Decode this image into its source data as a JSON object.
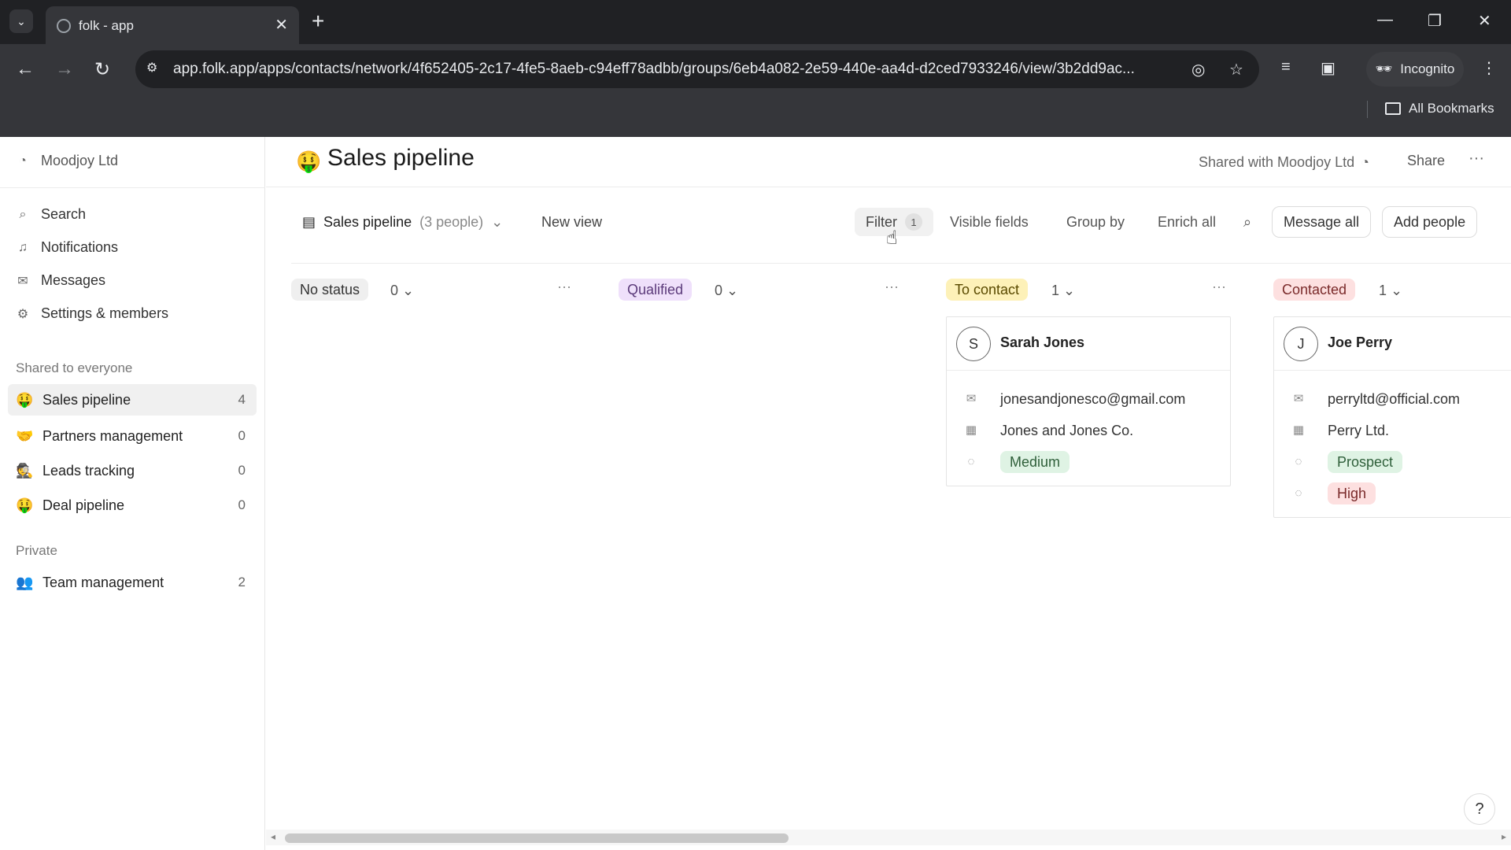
{
  "browser": {
    "tab_title": "folk - app",
    "url": "app.folk.app/apps/contacts/network/4f652405-2c17-4fe5-8aeb-c94eff78adbb/groups/6eb4a082-2e59-440e-aa4d-d2ced7933246/view/3b2dd9ac...",
    "incognito_label": "Incognito",
    "bookmarks_label": "All Bookmarks"
  },
  "sidebar": {
    "workspace": "Moodjoy Ltd",
    "nav": [
      {
        "label": "Search",
        "icon": "search-icon"
      },
      {
        "label": "Notifications",
        "icon": "bell-icon"
      },
      {
        "label": "Messages",
        "icon": "mail-icon"
      },
      {
        "label": "Settings & members",
        "icon": "gear-icon"
      }
    ],
    "shared_label": "Shared to everyone",
    "shared_groups": [
      {
        "emoji": "🤑",
        "label": "Sales pipeline",
        "count": "4"
      },
      {
        "emoji": "🤝",
        "label": "Partners management",
        "count": "0"
      },
      {
        "emoji": "🕵",
        "label": "Leads tracking",
        "count": "0"
      },
      {
        "emoji": "🤑",
        "label": "Deal pipeline",
        "count": "0"
      }
    ],
    "private_label": "Private",
    "private_groups": [
      {
        "emoji": "👥",
        "label": "Team management",
        "count": "2"
      }
    ]
  },
  "header": {
    "emoji": "🤑",
    "title": "Sales pipeline",
    "shared_with": "Shared with Moodjoy Ltd",
    "share": "Share"
  },
  "viewbar": {
    "view_name": "Sales pipeline",
    "view_count": "(3 people)",
    "new_view": "New view",
    "filter": "Filter",
    "filter_count": "1",
    "visible_fields": "Visible fields",
    "group_by": "Group by",
    "enrich_all": "Enrich all",
    "message_all": "Message all",
    "add_people": "Add people"
  },
  "columns": [
    {
      "status": "No status",
      "count": "0",
      "pill_bg": "#efefef",
      "pill_fg": "#333333",
      "cards": []
    },
    {
      "status": "Qualified",
      "count": "0",
      "pill_bg": "#efe0fb",
      "pill_fg": "#5b3a7a",
      "cards": []
    },
    {
      "status": "To contact",
      "count": "1",
      "pill_bg": "#fdf1b8",
      "pill_fg": "#5a4a00",
      "cards": [
        {
          "initial": "S",
          "name": "Sarah Jones",
          "email": "jonesandjonesco@gmail.com",
          "company": "Jones and Jones Co.",
          "tags": [
            {
              "label": "Medium",
              "bg": "#dff3e4",
              "fg": "#2f5f3a"
            }
          ]
        }
      ]
    },
    {
      "status": "Contacted",
      "count": "1",
      "pill_bg": "#fde0e0",
      "pill_fg": "#7a2a2a",
      "cards": [
        {
          "initial": "J",
          "name": "Joe Perry",
          "email": "perryltd@official.com",
          "company": "Perry Ltd.",
          "tags": [
            {
              "label": "Prospect",
              "bg": "#dff3e4",
              "fg": "#2f5f3a"
            },
            {
              "label": "High",
              "bg": "#fde0e0",
              "fg": "#7a2a2a"
            }
          ]
        }
      ]
    }
  ],
  "help": "?"
}
